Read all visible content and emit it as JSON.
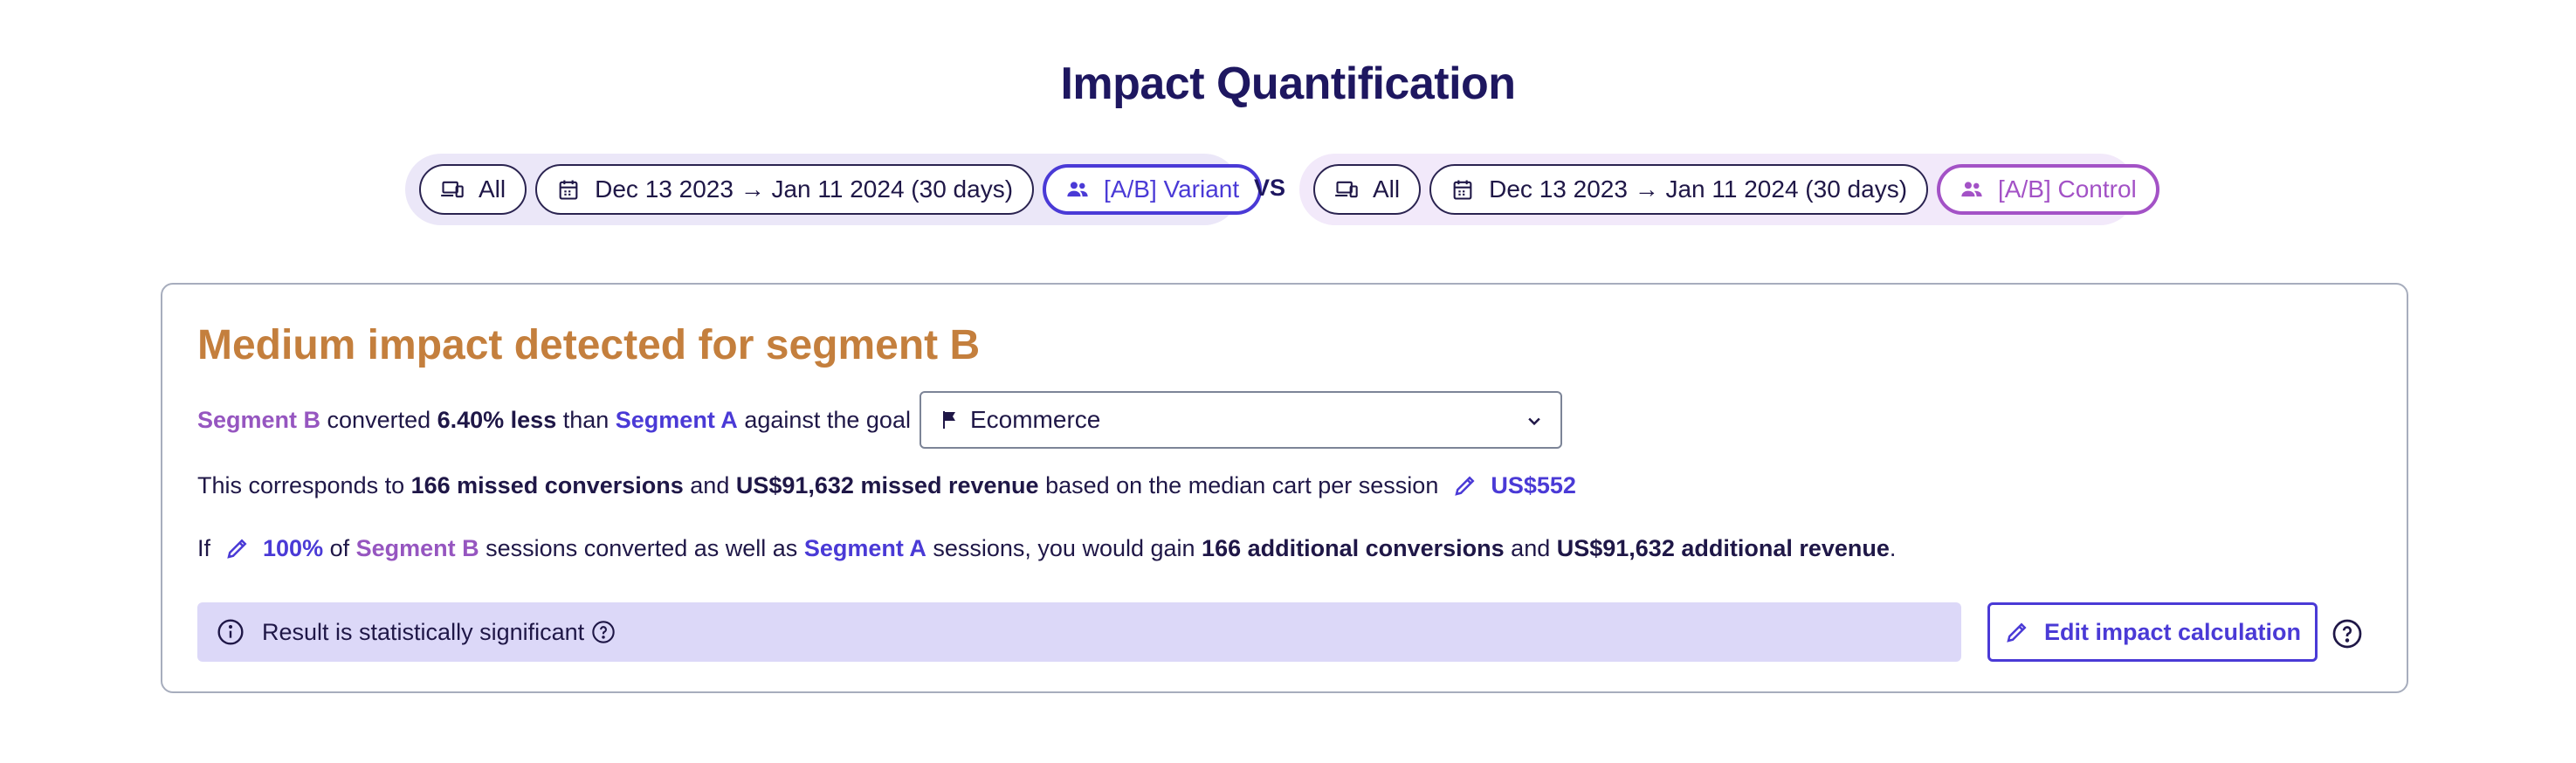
{
  "page": {
    "title": "Impact Quantification"
  },
  "segments": {
    "left": {
      "device_label": "All",
      "date_range": "Dec 13 2023 → Jan 11 2024 (30 days)",
      "segment_label": "[A/B] Variant",
      "accent_color": "#4a3ad6"
    },
    "vs_label": "VS",
    "right": {
      "device_label": "All",
      "date_range": "Dec 13 2023 → Jan 11 2024 (30 days)",
      "segment_label": "[A/B] Control",
      "accent_color": "#a352c6"
    }
  },
  "impact": {
    "headline": "Medium impact detected for segment B",
    "line1": {
      "segment_b": "Segment B",
      "t1": " converted ",
      "diff": "6.40% less",
      "t2": " than ",
      "segment_a": "Segment A",
      "t3": " against the goal"
    },
    "goal": {
      "selected": "Ecommerce"
    },
    "line2": {
      "t1": "This corresponds to ",
      "missed_conversions": "166 missed conversions",
      "t2": " and ",
      "missed_revenue": "US$91,632 missed revenue",
      "t3": " based on the median cart per session",
      "median_cart": "US$552"
    },
    "line3": {
      "t1": "If",
      "percent": "100%",
      "t2": " of ",
      "segment_b": "Segment B",
      "t3": " sessions converted as well as ",
      "segment_a": "Segment A",
      "t4": " sessions, you would gain ",
      "additional_conversions": "166 additional conversions",
      "t5": " and ",
      "additional_revenue": "US$91,632 additional revenue",
      "t6": "."
    },
    "status_text": "Result is statistically significant",
    "edit_button": "Edit impact calculation"
  },
  "colors": {
    "title": "#1e1760",
    "headline": "#c47f3d",
    "segment_a": "#4a3ad6",
    "segment_b": "#9656c0",
    "status_bg": "#dcd8f8"
  },
  "icons": {
    "device": "devices-icon",
    "calendar": "calendar-icon",
    "users": "users-icon",
    "flag": "flag-icon",
    "chevron": "chevron-down-icon",
    "pencil": "pencil-icon",
    "info": "info-icon",
    "help": "help-circle-icon"
  }
}
